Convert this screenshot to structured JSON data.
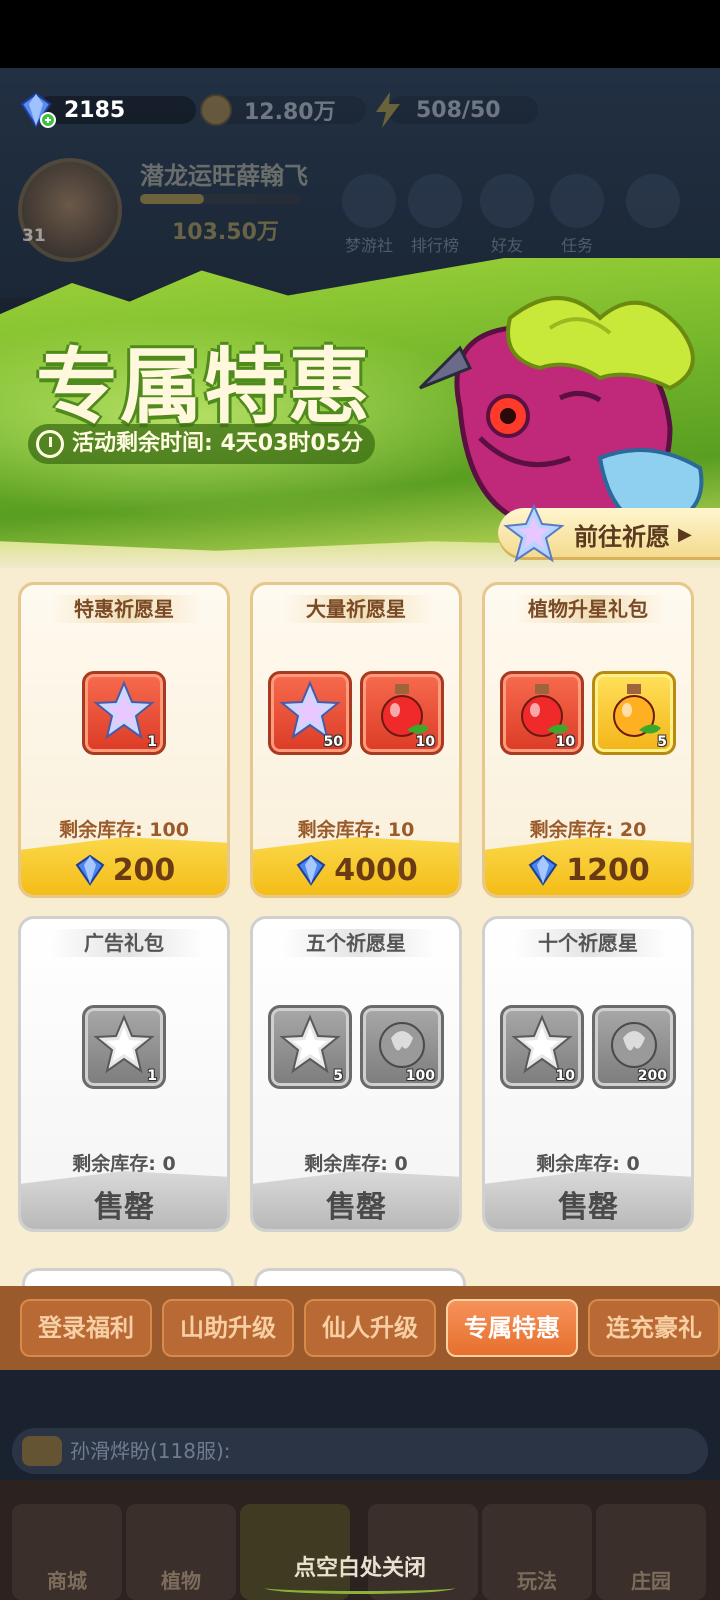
{
  "resources": {
    "gems": "2185",
    "gold": "12.80万",
    "energy": "508/50"
  },
  "player": {
    "name": "潜龙运旺薛翰飞",
    "level": "31",
    "power": "103.50万"
  },
  "hud_buttons": [
    "梦游社",
    "排行榜",
    "好友",
    "任务"
  ],
  "banner": {
    "title": "专属特惠",
    "timer_label": "活动剩余时间: 4天03时05分",
    "go_button": "前往祈愿"
  },
  "cards": [
    {
      "name": "特惠祈愿星",
      "items": [
        {
          "type": "star",
          "qty": "1"
        }
      ],
      "stock": "剩余库存: 100",
      "price": "200",
      "sold_out": false
    },
    {
      "name": "大量祈愿星",
      "items": [
        {
          "type": "star",
          "qty": "50"
        },
        {
          "type": "potion",
          "qty": "10"
        }
      ],
      "stock": "剩余库存: 10",
      "price": "4000",
      "sold_out": false
    },
    {
      "name": "植物升星礼包",
      "items": [
        {
          "type": "potion",
          "qty": "10"
        },
        {
          "type": "potion-gold",
          "qty": "5"
        }
      ],
      "stock": "剩余库存: 20",
      "price": "1200",
      "sold_out": false
    },
    {
      "name": "广告礼包",
      "items": [
        {
          "type": "star-gray",
          "qty": "1"
        }
      ],
      "stock": "剩余库存: 0",
      "price": "售罄",
      "sold_out": true
    },
    {
      "name": "五个祈愿星",
      "items": [
        {
          "type": "star-gray",
          "qty": "5"
        },
        {
          "type": "orb-gray",
          "qty": "100"
        }
      ],
      "stock": "剩余库存: 0",
      "price": "售罄",
      "sold_out": true
    },
    {
      "name": "十个祈愿星",
      "items": [
        {
          "type": "star-gray",
          "qty": "10"
        },
        {
          "type": "orb-gray",
          "qty": "200"
        }
      ],
      "stock": "剩余库存: 0",
      "price": "售罄",
      "sold_out": true
    }
  ],
  "tabs": [
    {
      "label": "登录福利",
      "active": false
    },
    {
      "label": "山助升级",
      "active": false
    },
    {
      "label": "仙人升级",
      "active": false
    },
    {
      "label": "专属特惠",
      "active": true
    },
    {
      "label": "连充豪礼",
      "active": false
    }
  ],
  "chat": {
    "text": "孙滑烨盼(118服):"
  },
  "bottom_nav": [
    "商城",
    "植物",
    "",
    "",
    "玩法",
    "庄园"
  ],
  "close_hint": "点空白处关闭",
  "colors": {
    "accent": "#e6702e",
    "price_bar": "#f4bd18",
    "banner_green": "#6fb229"
  }
}
